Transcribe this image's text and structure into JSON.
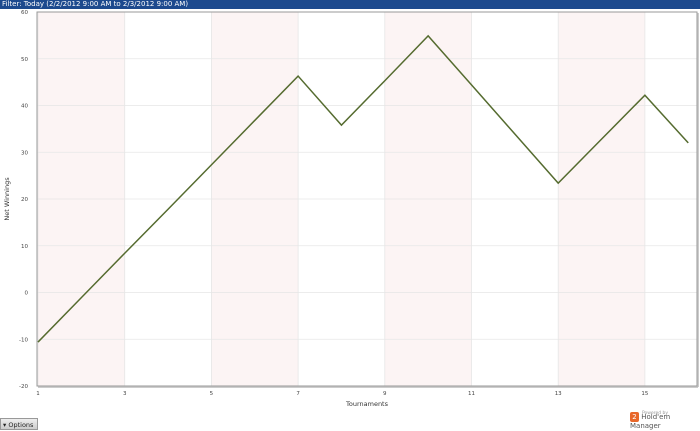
{
  "filter": {
    "text": "Filter: Today (2/2/2012 9:00 AM to 2/3/2012 9:00 AM)"
  },
  "chart_data": {
    "type": "line",
    "xlabel": "Tournaments",
    "ylabel": "Net Winnings",
    "xlim": [
      1,
      16.2
    ],
    "ylim": [
      -20,
      60
    ],
    "x_ticks": [
      1,
      3,
      5,
      7,
      9,
      11,
      13,
      15
    ],
    "y_ticks": [
      -20,
      -10,
      0,
      10,
      20,
      30,
      40,
      50,
      60
    ],
    "grid": true,
    "line_color": "#556b2f",
    "band_color": "#fcf4f4",
    "x": [
      1,
      2,
      3,
      4,
      5,
      6,
      7,
      8,
      9,
      10,
      11,
      12,
      13,
      14,
      15,
      16
    ],
    "values": [
      -10.6,
      -1.1,
      8.4,
      17.8,
      27.3,
      36.8,
      46.3,
      35.8,
      45.3,
      54.9,
      44.4,
      33.9,
      23.4,
      32.8,
      42.2,
      32.0
    ]
  },
  "footer": {
    "options_label": "Options",
    "options_icon": "triangle-down",
    "powered_by": "Powered by",
    "brand": "Hold'em Manager",
    "logo_text": "2"
  }
}
